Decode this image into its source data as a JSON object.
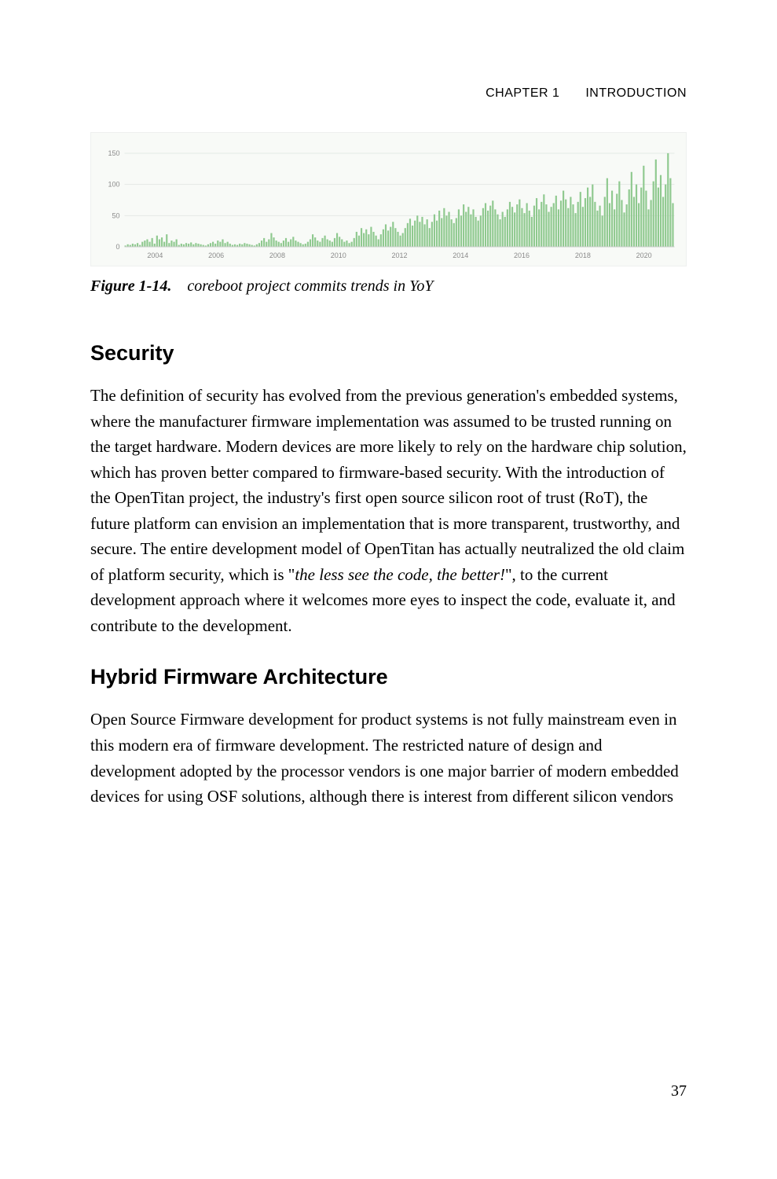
{
  "header": {
    "chapter": "CHAPTER 1",
    "title": "INTRODUCTION"
  },
  "figure": {
    "label": "Figure 1-14.",
    "caption": "coreboot project commits trends in YoY"
  },
  "section1": {
    "heading": "Security",
    "para_lead": "The definition of security has evolved from the previous generation's embedded systems, where the manufacturer firmware implementation was assumed to be trusted running on the target hardware. Modern devices are more likely to rely on the hardware chip solution, which has proven better compared to firmware-based security. With the introduction of the OpenTitan project, the industry's first open source silicon root of trust (RoT), the future platform can envision an implementation that is more transparent, trustworthy, and secure. The entire development model of OpenTitan has actually neutralized the old claim of platform security, which is \"",
    "para_italic": "the less see the code, the better!",
    "para_tail": "\", to the current development approach where it welcomes more eyes to inspect the code, evaluate it, and contribute to the development."
  },
  "section2": {
    "heading": "Hybrid Firmware Architecture",
    "para": "Open Source Firmware development for product systems is not fully mainstream even in this modern era of firmware development. The restricted nature of design and development adopted by the processor vendors is one major barrier of modern embedded devices for using OSF solutions, although there is interest from different silicon vendors"
  },
  "page_number": "37",
  "chart_data": {
    "type": "bar",
    "title": "",
    "xlabel": "",
    "ylabel": "",
    "ylim": [
      0,
      160
    ],
    "yticks": [
      0,
      50,
      100,
      150
    ],
    "xticks": [
      "2004",
      "2006",
      "2008",
      "2010",
      "2012",
      "2014",
      "2016",
      "2018",
      "2020"
    ],
    "x_start_year": 2003,
    "x_end_year": 2021,
    "values": [
      2,
      4,
      3,
      5,
      4,
      6,
      3,
      8,
      10,
      12,
      8,
      14,
      5,
      18,
      12,
      15,
      8,
      20,
      6,
      10,
      8,
      12,
      3,
      5,
      4,
      6,
      5,
      7,
      4,
      6,
      5,
      4,
      3,
      2,
      4,
      6,
      8,
      5,
      10,
      8,
      12,
      6,
      8,
      5,
      3,
      4,
      3,
      5,
      4,
      6,
      5,
      4,
      3,
      2,
      4,
      6,
      10,
      14,
      8,
      12,
      22,
      15,
      10,
      8,
      6,
      10,
      14,
      8,
      12,
      16,
      10,
      8,
      6,
      4,
      5,
      8,
      12,
      20,
      15,
      10,
      8,
      14,
      18,
      12,
      10,
      8,
      14,
      22,
      16,
      12,
      8,
      10,
      6,
      8,
      14,
      24,
      18,
      30,
      22,
      28,
      20,
      32,
      24,
      18,
      12,
      20,
      28,
      36,
      26,
      32,
      40,
      30,
      24,
      18,
      22,
      30,
      38,
      45,
      34,
      42,
      50,
      40,
      48,
      36,
      44,
      30,
      40,
      52,
      42,
      58,
      46,
      62,
      50,
      56,
      44,
      38,
      46,
      60,
      50,
      68,
      56,
      64,
      52,
      60,
      48,
      42,
      50,
      62,
      70,
      58,
      66,
      74,
      60,
      52,
      44,
      56,
      48,
      60,
      72,
      64,
      55,
      68,
      76,
      62,
      54,
      70,
      58,
      48,
      66,
      78,
      60,
      72,
      84,
      68,
      56,
      64,
      70,
      82,
      60,
      74,
      90,
      76,
      62,
      80,
      68,
      54,
      72,
      88,
      64,
      78,
      95,
      80,
      100,
      72,
      58,
      66,
      50,
      80,
      110,
      70,
      90,
      60,
      85,
      105,
      75,
      55,
      68,
      92,
      120,
      80,
      100,
      70,
      95,
      130,
      90,
      60,
      75,
      105,
      140,
      95,
      115,
      80,
      100,
      150,
      110,
      70
    ]
  }
}
